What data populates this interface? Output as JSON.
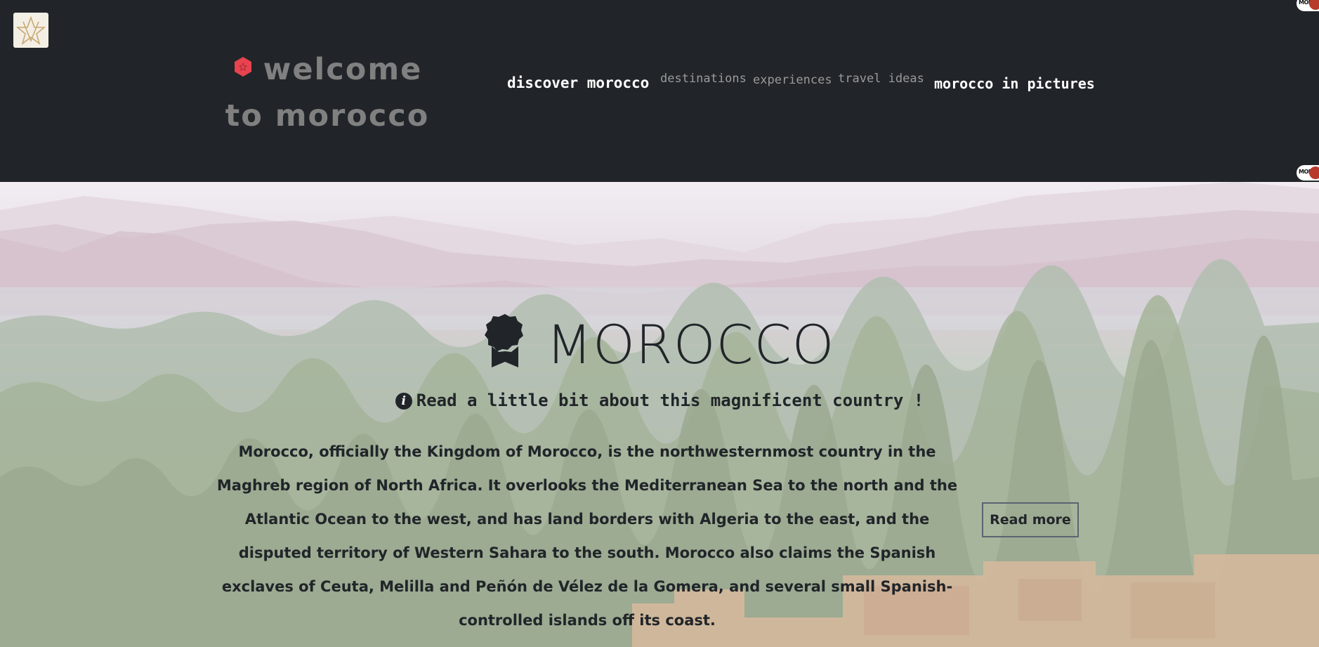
{
  "header": {
    "logo_icon": "pentagram-star-logo-icon",
    "brand_icon": "red-star-dot-icon",
    "brand_title": "welcome to morocco",
    "corner_badge_text": "MOR",
    "nav": {
      "discover": "discover morocco",
      "destinations": "destinations",
      "experiences": "experiences",
      "travel_ideas": "travel ideas",
      "pictures": "morocco in pictures"
    }
  },
  "hero": {
    "title_icon": "award-icon",
    "title": "MOROCCO",
    "subtitle_icon": "info-circle-icon",
    "subtitle": "Read a little bit about this magnificent country !",
    "description": "Morocco, officially the Kingdom of Morocco, is the northwesternmost country in the Maghreb region of North Africa. It overlooks the Mediterranean Sea to the north and the Atlantic Ocean to the west, and has land borders with Algeria to the east, and the disputed territory of Western Sahara to the south. Morocco also claims the Spanish exclaves of Ceuta, Melilla and Peñón de Vélez de la Gomera, and several small Spanish-controlled islands off its coast.",
    "read_more": "Read more"
  },
  "colors": {
    "header_bg": "#212529",
    "brand_text": "#808080",
    "nav_active": "#ffffff",
    "nav_muted": "#9a9a9a",
    "brand_dot": "#e8434f",
    "hero_text": "#212529"
  }
}
